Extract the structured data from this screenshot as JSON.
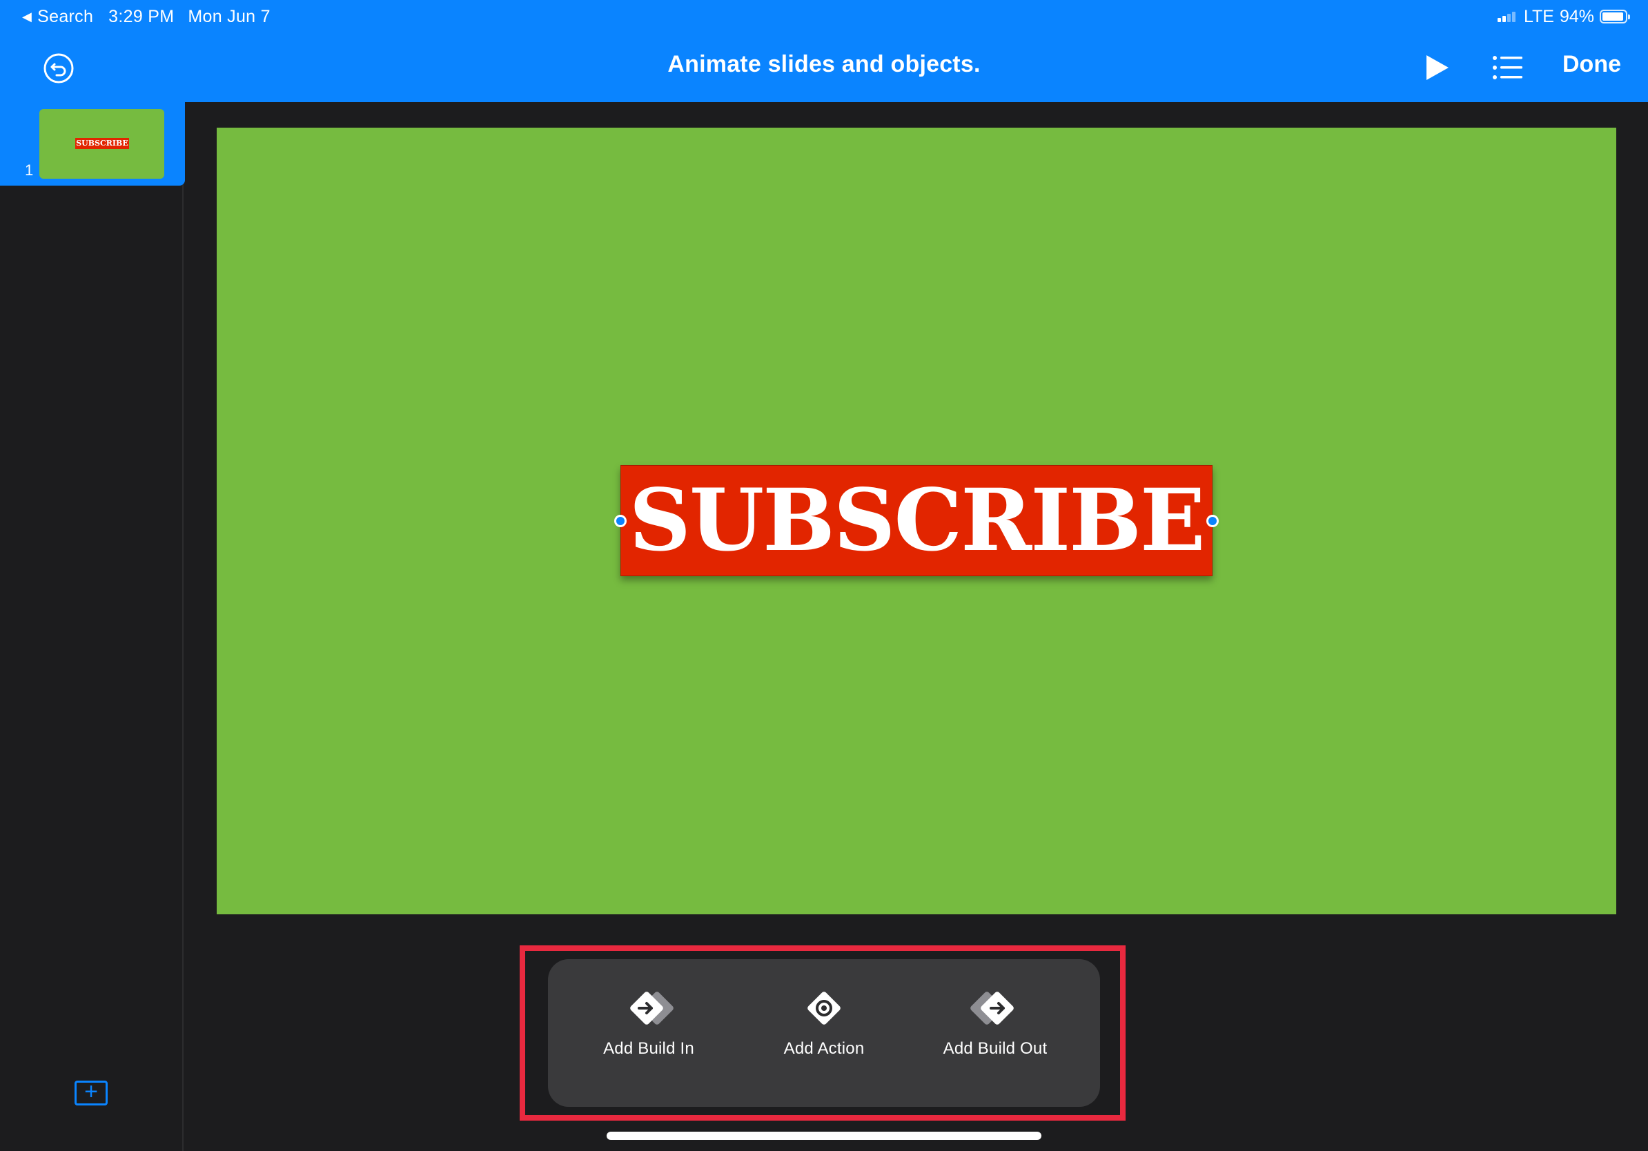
{
  "status_bar": {
    "back_label": "Search",
    "time": "3:29 PM",
    "date": "Mon Jun 7",
    "network": "LTE",
    "battery_percent": "94%",
    "battery_level": 0.94
  },
  "nav": {
    "title": "Animate slides and objects.",
    "done_label": "Done",
    "icons": {
      "undo": "undo-icon",
      "play": "play-icon",
      "outline": "list-icon"
    }
  },
  "sidebar": {
    "slides": [
      {
        "number": "1",
        "thumb_text": "SUBSCRIBE"
      }
    ],
    "add_slide_icon": "plus-icon"
  },
  "slide": {
    "background_color": "#76bb40",
    "object_text": "SUBSCRIBE",
    "object_color": "#e22500"
  },
  "animation_menu": {
    "options": [
      {
        "label": "Add Build In",
        "icon": "build-in-icon"
      },
      {
        "label": "Add Action",
        "icon": "action-icon"
      },
      {
        "label": "Add Build Out",
        "icon": "build-out-icon"
      }
    ]
  },
  "colors": {
    "accent": "#0a84ff",
    "highlight": "#e8293f",
    "background": "#1c1c1e",
    "popover": "#3a3a3c"
  }
}
